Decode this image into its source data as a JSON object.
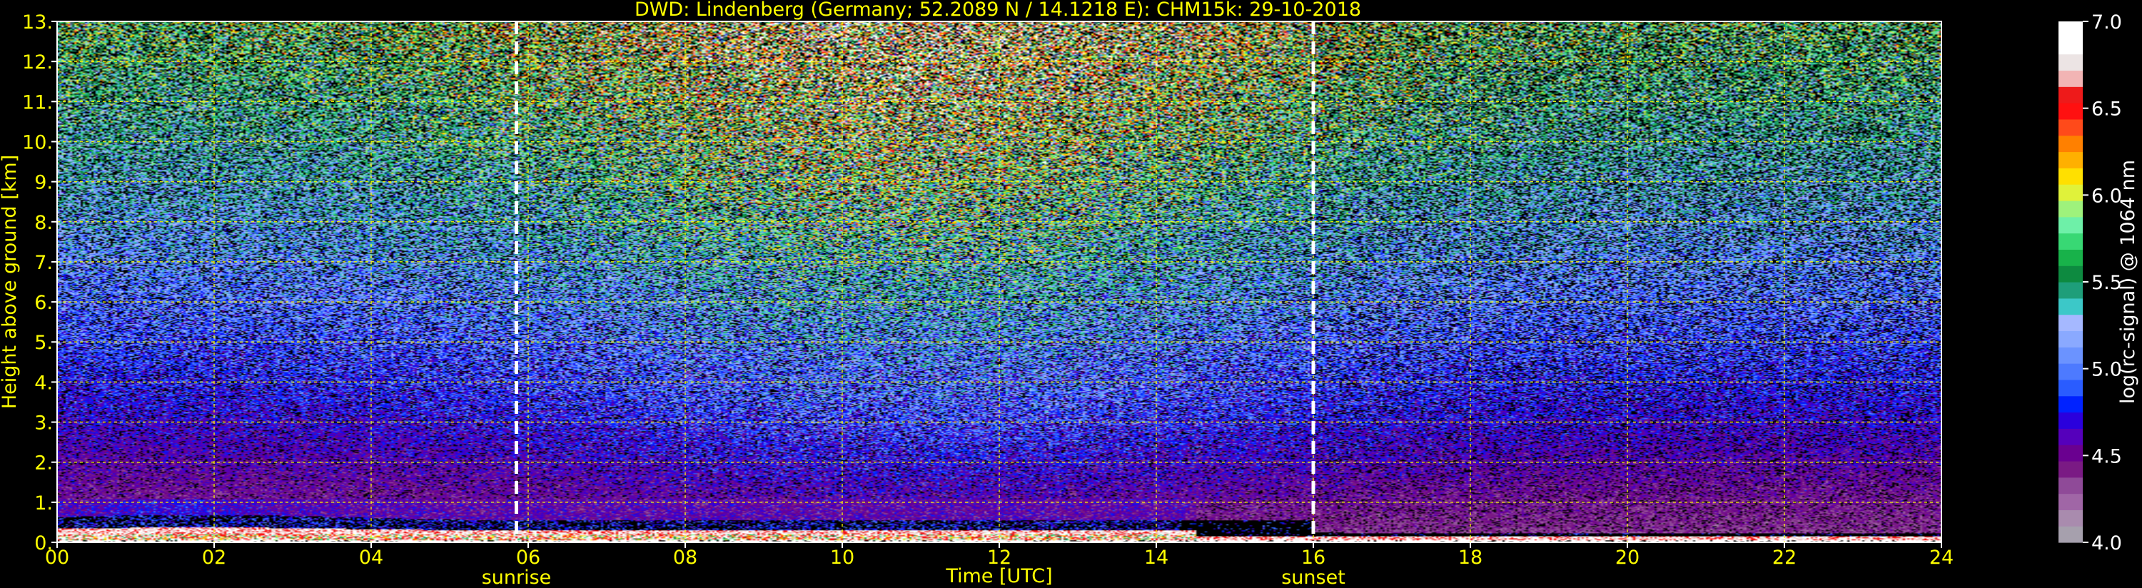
{
  "chart_data": {
    "type": "heatmap",
    "title": "DWD: Lindenberg (Germany; 52.2089 N / 14.1218 E):    CHM15k: 29-10-2018",
    "xlabel": "Time [UTC]",
    "ylabel": "Height above ground [km]",
    "xlim": [
      0,
      24
    ],
    "ylim": [
      0,
      13
    ],
    "xticks": [
      "00",
      "02",
      "04",
      "06",
      "08",
      "10",
      "12",
      "14",
      "16",
      "18",
      "20",
      "22",
      "24"
    ],
    "yticks": [
      "0.",
      "1.",
      "2.",
      "3.",
      "4.",
      "5.",
      "6.",
      "7.",
      "8.",
      "9.",
      "10.",
      "11.",
      "12.",
      "13."
    ],
    "grid": true,
    "grid_color": "#ffff00",
    "annotations": [
      {
        "label": "sunrise",
        "x": 5.85
      },
      {
        "label": "sunset",
        "x": 16.0
      }
    ],
    "colorbar": {
      "label": "log(rc-signal) @ 1064 nm",
      "range": [
        4.0,
        7.0
      ],
      "ticks": [
        "4.0",
        "4.5",
        "5.0",
        "5.5",
        "6.0",
        "6.5",
        "7.0"
      ],
      "colors": [
        "#a6a0ad",
        "#a98bae",
        "#a066a6",
        "#8f4a98",
        "#7a1a84",
        "#6a0090",
        "#5500bb",
        "#2a00dd",
        "#0022ff",
        "#2a5cff",
        "#4d7aff",
        "#6b93ff",
        "#8aa9ff",
        "#a5b8ff",
        "#3cc8c8",
        "#1e9e7a",
        "#0d8a40",
        "#18b24a",
        "#38d874",
        "#6ef0a8",
        "#9ef27c",
        "#e0f23a",
        "#ffe000",
        "#ffb000",
        "#ff8000",
        "#ff4a1a",
        "#ff1010",
        "#ee1a1a",
        "#f2b4b4",
        "#ece4e4",
        "#ffffff",
        "#ffffff"
      ]
    },
    "colors": {
      "text": "#ffff00",
      "colorbar_text": "#ffffff",
      "background": "#000000"
    }
  }
}
